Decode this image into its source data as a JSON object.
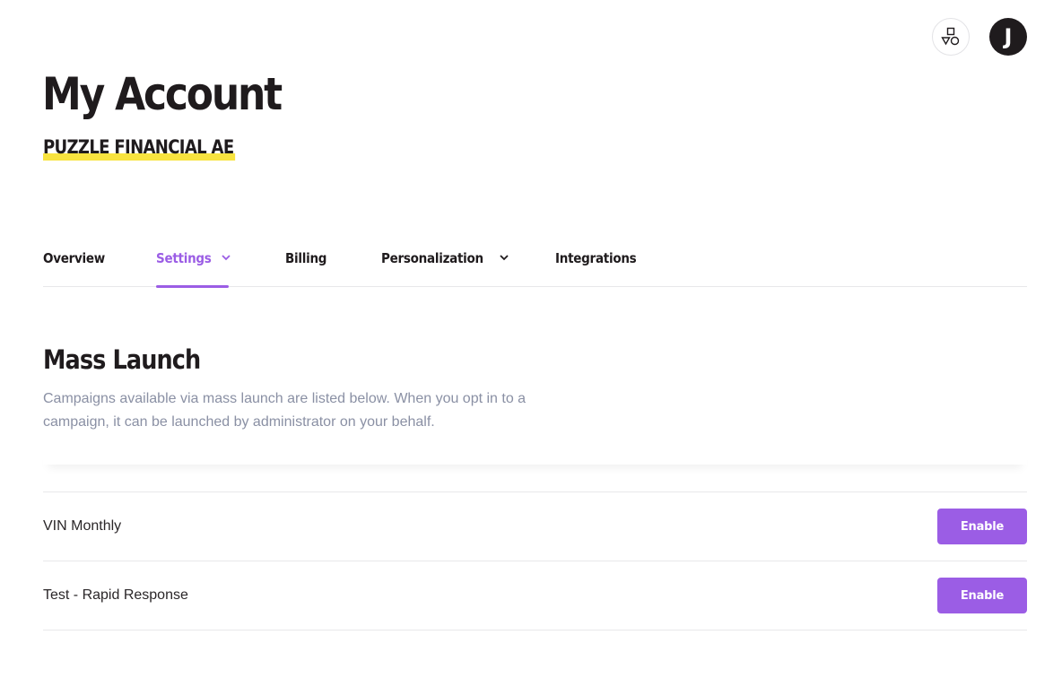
{
  "header": {
    "title": "My Account",
    "organization": "PUZZLE FINANCIAL AE",
    "avatar_initial": "J",
    "shapes_icon": "shapes-icon"
  },
  "tabs": [
    {
      "label": "Overview",
      "active": false,
      "has_chevron": false
    },
    {
      "label": "Settings",
      "active": true,
      "has_chevron": true
    },
    {
      "label": "Billing",
      "active": false,
      "has_chevron": false
    },
    {
      "label": "Personalization",
      "active": false,
      "has_chevron": true
    },
    {
      "label": "Integrations",
      "active": false,
      "has_chevron": false
    }
  ],
  "section": {
    "title": "Mass Launch",
    "description": "Campaigns available via mass launch are listed below. When you opt in to a campaign, it can be launched by administrator on your behalf."
  },
  "campaigns": [
    {
      "name": "VIN Monthly",
      "action_label": "Enable"
    },
    {
      "name": "Test - Rapid Response",
      "action_label": "Enable"
    }
  ],
  "colors": {
    "accent": "#9b5de5",
    "highlight": "#f8e33f",
    "text": "#1f1b1d",
    "muted": "#8a90a4"
  }
}
